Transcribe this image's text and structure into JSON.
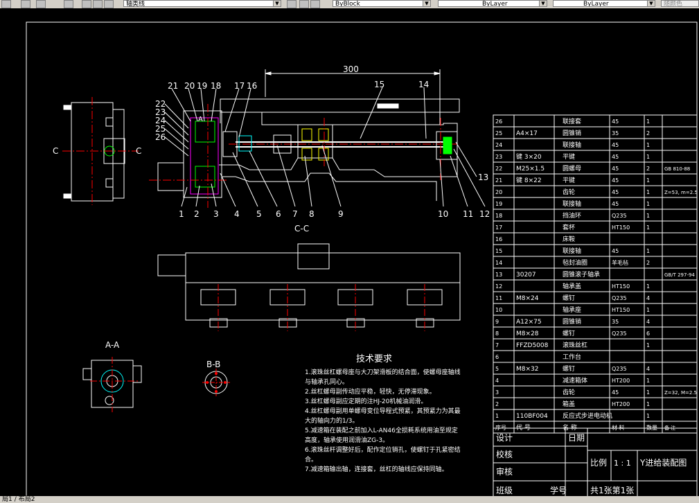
{
  "toolbar": {
    "layer_combo": "轴类线",
    "linetype_combo": "ByBlock",
    "lineweight_combo": "ByLayer",
    "plotstyle_combo": "ByLayer",
    "color_combo": "随颜色"
  },
  "drawing": {
    "dimension_300": "300",
    "section_cc": "C-C",
    "section_aa": "A-A",
    "section_bb": "B-B",
    "label_c_left": "C",
    "label_c_right": "C",
    "label_a": "A",
    "callouts_top": [
      "21",
      "20",
      "19",
      "18",
      "17",
      "16",
      "15",
      "14"
    ],
    "callouts_left": [
      "22",
      "23",
      "24",
      "25",
      "26"
    ],
    "callouts_bottom": [
      "1",
      "2",
      "3",
      "4",
      "5",
      "6",
      "7",
      "8",
      "9",
      "10",
      "11",
      "12"
    ],
    "callout_13": "13"
  },
  "tech": {
    "title": "技术要求",
    "lines": [
      "1.滚珠丝杠螺母座与大刀架滑板的结合面，使螺母座轴线",
      "与轴承孔同心。",
      "2.丝杠螺母副传动应平稳，轻快，无停滞现象。",
      "3.丝杠螺母副应定期的注HJ-20机械油润滑。",
      "4.丝杠螺母副用单螺母变位导程式预紧，其预紧力为其最",
      "大的轴向力的1/3。",
      "5.减速箱在装配之前加入L-AN46全损耗系统用油至规定",
      "高度，轴承使用润滑油ZG-3。",
      "6.滚珠丝杆调整好后，配作定位销孔，使螺钉于孔紧密结",
      "合。",
      "7.减速箱输出轴，连接套，丝杠的轴线应保持同轴。"
    ]
  },
  "bom": {
    "rows": [
      [
        "26",
        "",
        "联接套",
        "45",
        "1",
        ""
      ],
      [
        "25",
        "A4×17",
        "圆锥销",
        "35",
        "2",
        ""
      ],
      [
        "24",
        "",
        "联接轴",
        "45",
        "1",
        ""
      ],
      [
        "23",
        "键 3×20",
        "平键",
        "45",
        "1",
        ""
      ],
      [
        "22",
        "M25×1.5",
        "圆螺母",
        "45",
        "2",
        "GB 810-88"
      ],
      [
        "21",
        "键 8×22",
        "平键",
        "45",
        "1",
        ""
      ],
      [
        "20",
        "",
        "齿轮",
        "45",
        "1",
        "Z=53, m=2.5"
      ],
      [
        "19",
        "",
        "联接轴",
        "45",
        "1",
        ""
      ],
      [
        "18",
        "",
        "挡油环",
        "Q235",
        "1",
        ""
      ],
      [
        "17",
        "",
        "套杯",
        "HT150",
        "1",
        ""
      ],
      [
        "16",
        "",
        "床鞍",
        "",
        "",
        ""
      ],
      [
        "15",
        "",
        "联接轴",
        "45",
        "1",
        ""
      ],
      [
        "14",
        "",
        "毡封油圈",
        "羊毛毡",
        "2",
        ""
      ],
      [
        "13",
        "30207",
        "圆锥滚子轴承",
        "",
        "",
        "GB/T 297-94"
      ],
      [
        "12",
        "",
        "轴承盖",
        "HT150",
        "1",
        ""
      ],
      [
        "11",
        "M8×24",
        "螺钉",
        "Q235",
        "4",
        ""
      ],
      [
        "10",
        "",
        "轴承座",
        "HT150",
        "1",
        ""
      ],
      [
        "9",
        "A12×75",
        "圆锥销",
        "35",
        "4",
        ""
      ],
      [
        "8",
        "M8×28",
        "螺钉",
        "Q235",
        "6",
        ""
      ],
      [
        "7",
        "FFZD5008",
        "滚珠丝杠",
        "",
        "1",
        ""
      ],
      [
        "6",
        "",
        "工作台",
        "",
        "",
        ""
      ],
      [
        "5",
        "M8×32",
        "螺钉",
        "Q235",
        "4",
        ""
      ],
      [
        "4",
        "",
        "减速箱体",
        "HT200",
        "1",
        ""
      ],
      [
        "3",
        "",
        "齿轮",
        "45",
        "1",
        "Z=32, M=2.5"
      ],
      [
        "2",
        "",
        "箱盖",
        "HT200",
        "1",
        ""
      ],
      [
        "1",
        "110BF004",
        "反应式步进电动机",
        "",
        "1",
        ""
      ]
    ],
    "header": [
      "序号",
      "代 号",
      "名 称",
      "材 料",
      "数量",
      "备 注"
    ]
  },
  "title_block": {
    "design": "设计",
    "date": "日期",
    "check": "校核",
    "review": "审核",
    "class": "班级",
    "student_id": "学号",
    "scale_label": "比例",
    "scale_value": "1 : 1",
    "drawing_title": "Y进给装配图",
    "sheets": "共1张第1张"
  },
  "tabs": [
    "局1",
    "布局2"
  ]
}
